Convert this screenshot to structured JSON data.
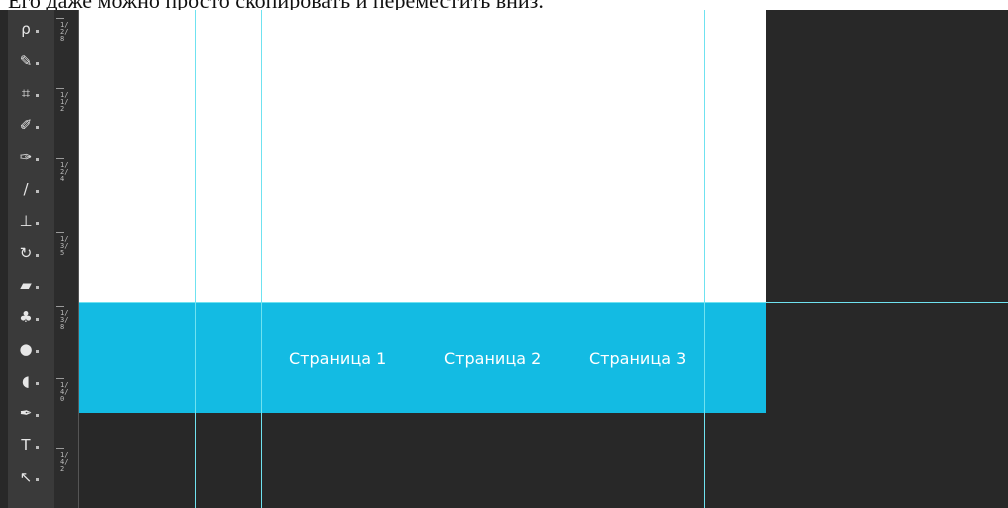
{
  "caption": {
    "text": "Его даже можно просто скопировать и переместить вниз."
  },
  "toolbar": {
    "tools": [
      {
        "name": "lasso-tool",
        "icon": "lasso-icon",
        "glyph": "ρ"
      },
      {
        "name": "quick-selection-tool",
        "icon": "quick-selection-icon",
        "glyph": "✎"
      },
      {
        "name": "crop-tool",
        "icon": "crop-icon",
        "glyph": "⌗"
      },
      {
        "name": "eyedropper-tool",
        "icon": "eyedropper-icon",
        "glyph": "✐"
      },
      {
        "name": "healing-brush-tool",
        "icon": "healing-brush-icon",
        "glyph": "✑"
      },
      {
        "name": "brush-tool",
        "icon": "brush-icon",
        "glyph": "/"
      },
      {
        "name": "clone-stamp-tool",
        "icon": "clone-stamp-icon",
        "glyph": "⊥"
      },
      {
        "name": "history-brush-tool",
        "icon": "history-brush-icon",
        "glyph": "↻"
      },
      {
        "name": "eraser-tool",
        "icon": "eraser-icon",
        "glyph": "▰"
      },
      {
        "name": "paint-bucket-tool",
        "icon": "paint-bucket-icon",
        "glyph": "♣"
      },
      {
        "name": "blur-tool",
        "icon": "blur-drop-icon",
        "glyph": "●"
      },
      {
        "name": "dodge-tool",
        "icon": "dodge-icon",
        "glyph": "◖"
      },
      {
        "name": "pen-tool",
        "icon": "pen-icon",
        "glyph": "✒"
      },
      {
        "name": "type-tool",
        "icon": "type-icon",
        "glyph": "T"
      },
      {
        "name": "path-selection-tool",
        "icon": "path-selection-icon",
        "glyph": "↖"
      }
    ]
  },
  "ruler": {
    "labels": [
      "1/2/8",
      "1/1/2",
      "1/2/4",
      "1/3/5",
      "1/3/8",
      "1/4/0",
      "1/4/2"
    ]
  },
  "nav": {
    "items": [
      "Страница 1",
      "Страница 2",
      "Страница 3"
    ]
  },
  "colors": {
    "nav_background": "#13bbe3",
    "canvas": "#ffffff",
    "workspace": "#282828",
    "guide": "#6fe2f0",
    "toolbar": "#3a3a3a"
  }
}
